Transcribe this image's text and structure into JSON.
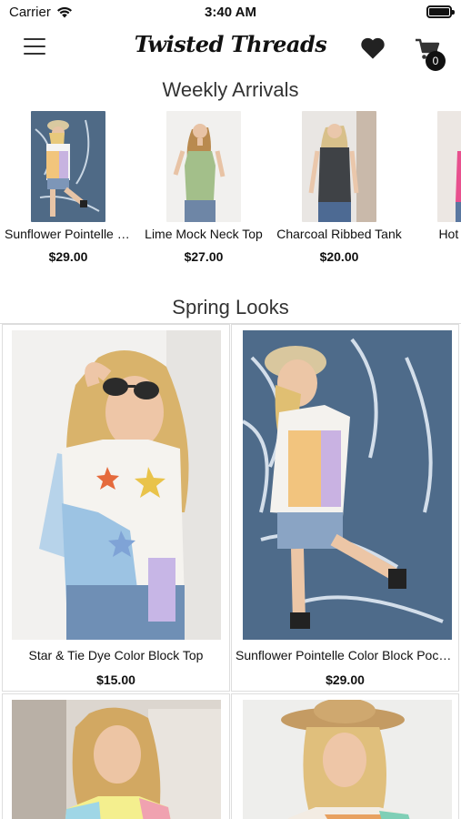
{
  "status_bar": {
    "carrier": "Carrier",
    "time": "3:40 AM"
  },
  "header": {
    "brand": "Twisted Threads",
    "cart_count": "0"
  },
  "weekly_arrivals": {
    "title": "Weekly Arrivals",
    "items": [
      {
        "name": "Sunflower Pointelle Color Block Top",
        "price": "$29.00"
      },
      {
        "name": "Lime Mock Neck Top",
        "price": "$27.00"
      },
      {
        "name": "Charcoal Ribbed Tank",
        "price": "$20.00"
      },
      {
        "name": "Hot Pink Top",
        "price": "$"
      }
    ]
  },
  "spring_looks": {
    "title": "Spring Looks",
    "items": [
      {
        "name": "Star & Tie Dye Color Block Top",
        "price": "$15.00"
      },
      {
        "name": "Sunflower Pointelle Color Block Pocket Top",
        "price": "$29.00"
      },
      {
        "name": "",
        "price": ""
      },
      {
        "name": "",
        "price": ""
      }
    ]
  }
}
